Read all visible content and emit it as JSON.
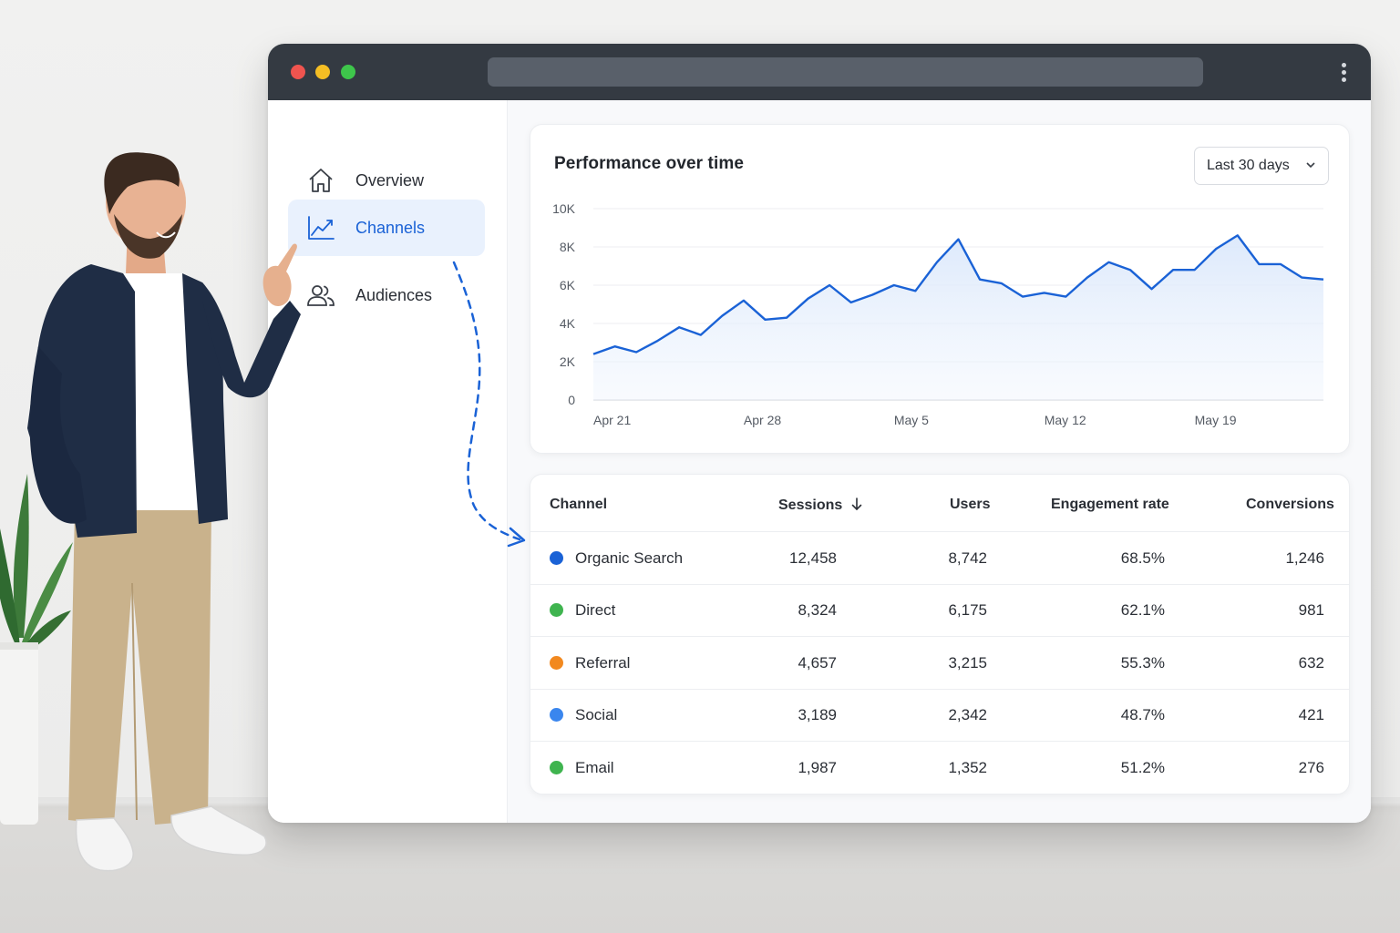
{
  "sidebar": {
    "items": [
      {
        "label": "Overview",
        "icon": "home-icon",
        "active": false
      },
      {
        "label": "Channels",
        "icon": "line-chart-icon",
        "active": true
      },
      {
        "label": "Audiences",
        "icon": "users-icon",
        "active": false
      }
    ]
  },
  "chart_card": {
    "title": "Performance over time",
    "range_label": "Last 30 days"
  },
  "chart_data": {
    "type": "area",
    "x_tick_labels": [
      "Apr 21",
      "Apr 28",
      "May 5",
      "May 12",
      "May 19"
    ],
    "y_tick_labels": [
      "0",
      "2K",
      "4K",
      "6K",
      "8K",
      "10K"
    ],
    "ylim": [
      0,
      10000
    ],
    "x_start_date": "2024-04-21",
    "grid": true,
    "series": [
      {
        "values": [
          2400,
          2800,
          2500,
          3100,
          3800,
          3400,
          4400,
          5200,
          4200,
          4300,
          5300,
          6000,
          5100,
          5500,
          6000,
          5700,
          7200,
          8400,
          6300,
          6100,
          5400,
          5600,
          5400,
          6400,
          7200,
          6800,
          5800,
          6800,
          6800,
          7900,
          8600,
          7100,
          7100,
          6400,
          6300
        ],
        "color": "#1a62d6"
      }
    ]
  },
  "table": {
    "headers": {
      "channel": "Channel",
      "sessions": "Sessions",
      "users": "Users",
      "engagement": "Engagement rate",
      "conversions": "Conversions"
    },
    "rows": [
      {
        "channel": "Organic Search",
        "color": "#1a62d6",
        "sessions": "12,458",
        "users": "8,742",
        "engagement": "68.5%",
        "conversions": "1,246"
      },
      {
        "channel": "Direct",
        "color": "#3fb44f",
        "sessions": "8,324",
        "users": "6,175",
        "engagement": "62.1%",
        "conversions": "981"
      },
      {
        "channel": "Referral",
        "color": "#f2891f",
        "sessions": "4,657",
        "users": "3,215",
        "engagement": "55.3%",
        "conversions": "632"
      },
      {
        "channel": "Social",
        "color": "#3a86ee",
        "sessions": "3,189",
        "users": "2,342",
        "engagement": "48.7%",
        "conversions": "421"
      },
      {
        "channel": "Email",
        "color": "#3fb44f",
        "sessions": "1,987",
        "users": "1,352",
        "engagement": "51.2%",
        "conversions": "276"
      }
    ]
  }
}
